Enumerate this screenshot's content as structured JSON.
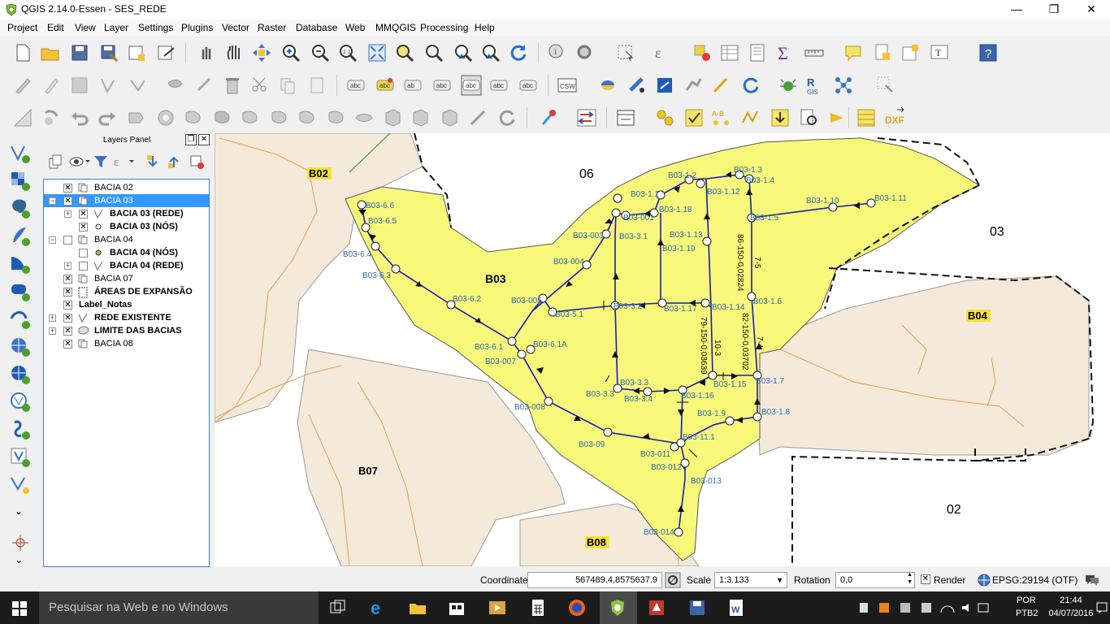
{
  "window": {
    "title": "QGIS 2.14.0-Essen - SES_REDE",
    "minimize": "—",
    "maximize": "❐",
    "close": "✕"
  },
  "menu": [
    "Project",
    "Edit",
    "View",
    "Layer",
    "Settings",
    "Plugins",
    "Vector",
    "Raster",
    "Database",
    "Web",
    "MMQGIS",
    "Processing",
    "Help"
  ],
  "layers_panel": {
    "title": "Layers Panel",
    "layers": [
      {
        "name": "BACIA 02",
        "checked": true,
        "bold": false,
        "selected": false,
        "indent": 0,
        "expander": "",
        "icon": "polygon-layer-icon"
      },
      {
        "name": "BACIA 03",
        "checked": true,
        "bold": false,
        "selected": true,
        "indent": 0,
        "expander": "−",
        "icon": "group-icon"
      },
      {
        "name": "BACIA 03 (REDE)",
        "checked": true,
        "bold": true,
        "selected": false,
        "indent": 1,
        "expander": "+",
        "icon": "line-layer-icon"
      },
      {
        "name": "BACIA 03 (NÓS)",
        "checked": true,
        "bold": true,
        "selected": false,
        "indent": 1,
        "expander": "",
        "icon": "point-layer-icon"
      },
      {
        "name": "BACIA 04",
        "checked": false,
        "bold": false,
        "selected": false,
        "indent": 0,
        "expander": "−",
        "icon": "group-icon"
      },
      {
        "name": "BACIA 04 (NÓS)",
        "checked": false,
        "bold": true,
        "selected": false,
        "indent": 1,
        "expander": "",
        "icon": "point-layer-icon-green"
      },
      {
        "name": "BACIA 04 (REDE)",
        "checked": false,
        "bold": true,
        "selected": false,
        "indent": 1,
        "expander": "+",
        "icon": "line-layer-icon"
      },
      {
        "name": "BACIA 07",
        "checked": true,
        "bold": false,
        "selected": false,
        "indent": 0,
        "expander": "",
        "icon": "polygon-layer-icon"
      },
      {
        "name": "ÁREAS DE EXPANSÃO",
        "checked": true,
        "bold": true,
        "selected": false,
        "indent": 0,
        "expander": "",
        "icon": "dashed-polygon-icon"
      },
      {
        "name": "Label_Notas",
        "checked": true,
        "bold": true,
        "selected": false,
        "indent": 0,
        "expander": "",
        "icon": "none"
      },
      {
        "name": "REDE EXISTENTE",
        "checked": true,
        "bold": true,
        "selected": false,
        "indent": 0,
        "expander": "+",
        "icon": "line-layer-icon"
      },
      {
        "name": "LIMITE DAS BACIAS",
        "checked": true,
        "bold": true,
        "selected": false,
        "indent": 0,
        "expander": "+",
        "icon": "polygon-outline-icon"
      },
      {
        "name": "BACIA 08",
        "checked": true,
        "bold": false,
        "selected": false,
        "indent": 0,
        "expander": "",
        "icon": "polygon-layer-icon"
      }
    ]
  },
  "map": {
    "basin_labels": [
      {
        "text": "B02"
      },
      {
        "text": "B03"
      },
      {
        "text": "B04"
      },
      {
        "text": "B07"
      },
      {
        "text": "B08"
      }
    ],
    "zone_labels": [
      {
        "text": "06"
      },
      {
        "text": "03"
      },
      {
        "text": "02"
      }
    ],
    "node_labels": [
      "B03-1.3",
      "B03-1.2",
      "B03-1.4",
      "B03-1.1",
      "B03-1.12",
      "B03-1.10",
      "B03-1.11",
      "B03-6.6",
      "B03-001",
      "B03-1.18",
      "B03-1.5",
      "B03-6.5",
      "B03-003",
      "B03-3.1",
      "B03-1.13",
      "B03-1.19",
      "B03-6.4",
      "B03-004",
      "B03-6.3",
      "B03-6.2",
      "B03-005",
      "B03-5.1",
      "B03-3.2",
      "B03-1.17",
      "B03-1.14",
      "B03-1.6",
      "B03-6.1",
      "B03-6.1A",
      "B03-007",
      "B03-3.3",
      "B03-3.3",
      "B03-3.4",
      "B03-1.16",
      "B03-1.15",
      "B03-1.7",
      "B03-008",
      "B03-1.9",
      "B03-1.8",
      "B03-09",
      "B03-11.1",
      "B03-011",
      "B03-012",
      "B03-013",
      "B03-014",
      "B03"
    ],
    "pipe_labels": [
      "86-150-0,02824",
      "7-5",
      "82-150-0,03702",
      "7-4",
      "79-150-0,03639",
      "10-3"
    ]
  },
  "status": {
    "coordinate_label": "Coordinate",
    "coordinate_value": "567489.4,8575637.9",
    "scale_label": "Scale",
    "scale_value": "1:3.133",
    "rotation_label": "Rotation",
    "rotation_value": "0,0",
    "render_label": "Render",
    "render_checked": true,
    "crs": "EPSG:29194 (OTF)"
  },
  "taskbar": {
    "search_placeholder": "Pesquisar na Web e no Windows",
    "lang1": "POR",
    "lang2": "PTB2",
    "time": "21:44",
    "date": "04/07/2016"
  },
  "colors": {
    "basin_yellow": "#f7f77a",
    "basin_beige": "#f5e9da",
    "pipe_blue": "#1b1bb0",
    "label_blue": "#2a6db5",
    "selection_blue": "#3399ff"
  }
}
